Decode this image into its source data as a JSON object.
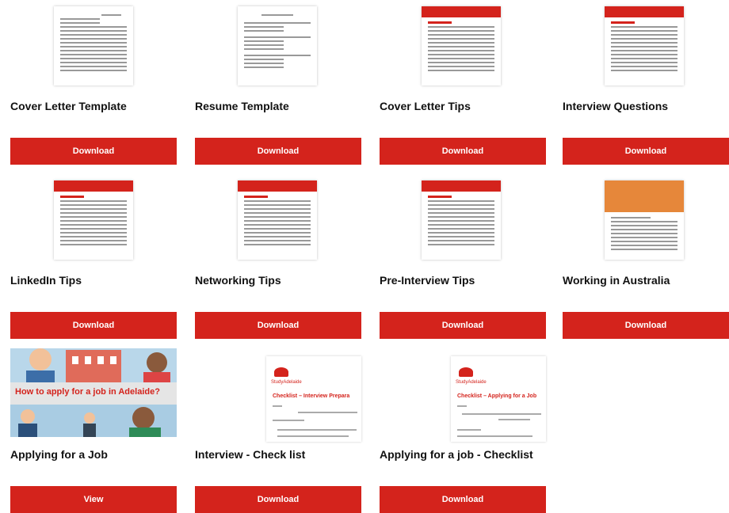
{
  "items": [
    {
      "title": "Cover Letter Template",
      "button": "Download",
      "thumb": "document-icon"
    },
    {
      "title": "Resume Template",
      "button": "Download",
      "thumb": "document-icon"
    },
    {
      "title": "Cover Letter Tips",
      "button": "Download",
      "thumb": "document-icon"
    },
    {
      "title": "Interview Questions",
      "button": "Download",
      "thumb": "document-icon"
    },
    {
      "title": "LinkedIn Tips",
      "button": "Download",
      "thumb": "document-icon"
    },
    {
      "title": "Networking Tips",
      "button": "Download",
      "thumb": "document-icon"
    },
    {
      "title": "Pre-Interview Tips",
      "button": "Download",
      "thumb": "document-icon"
    },
    {
      "title": "Working in Australia",
      "button": "Download",
      "thumb": "document-icon"
    },
    {
      "title": "Applying for a Job",
      "button": "View",
      "thumb": "video-thumbnail",
      "thumb_text": "How to apply for a job in Adelaide?"
    },
    {
      "title": "Interview - Check list",
      "button": "Download",
      "thumb": "checklist-icon",
      "thumb_text": "Checklist – Interview Prepara"
    },
    {
      "title": "Applying for a job - Checklist",
      "button": "Download",
      "thumb": "checklist-icon",
      "thumb_text": "Checklist – Applying for a Job"
    }
  ],
  "brand": {
    "button_color": "#d4231c"
  }
}
